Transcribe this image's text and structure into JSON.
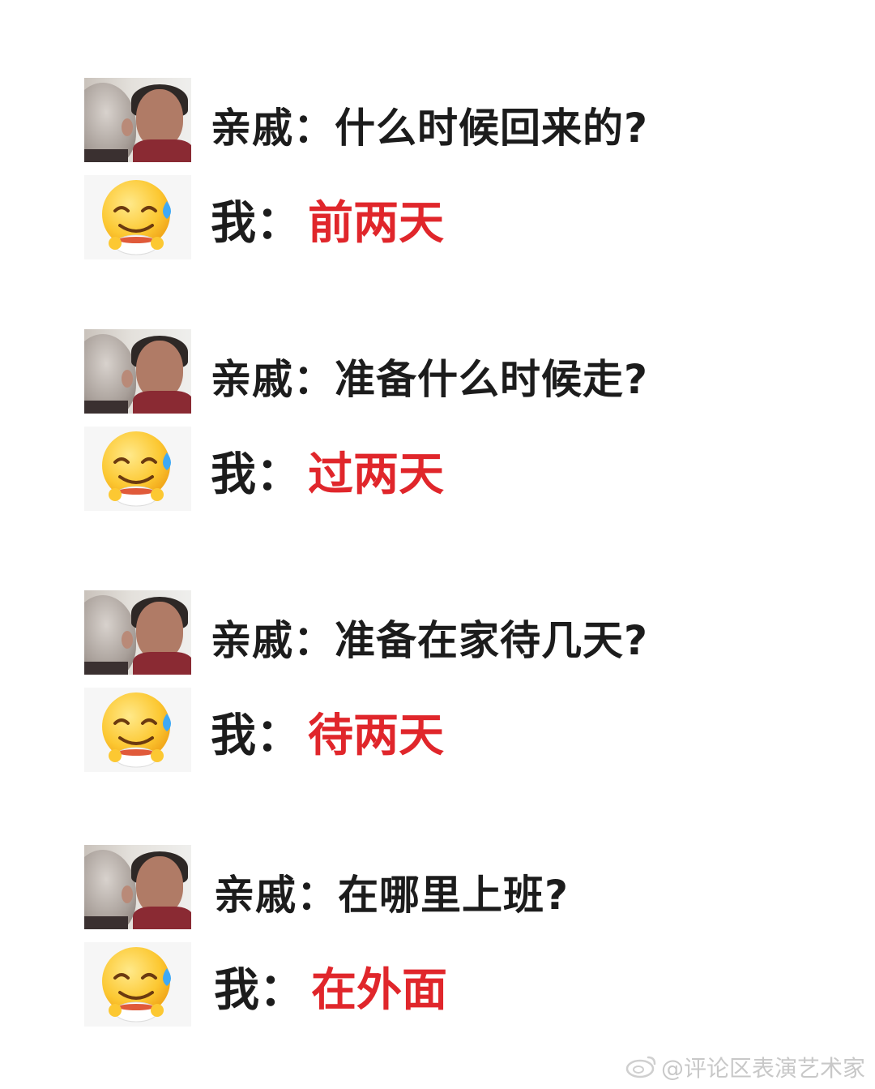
{
  "pairs": [
    {
      "speaker": "亲戚：",
      "question": "什么时候回来的?",
      "me": "我：",
      "answer": "前两天"
    },
    {
      "speaker": "亲戚：",
      "question": "准备什么时候走?",
      "me": "我：",
      "answer": "过两天"
    },
    {
      "speaker": "亲戚：",
      "question": "准备在家待几天?",
      "me": "我：",
      "answer": "待两天"
    },
    {
      "speaker": "亲戚：",
      "question": "在哪里上班?",
      "me": "我：",
      "answer": "在外面"
    }
  ],
  "watermark": "@评论区表演艺术家",
  "icons": {
    "relative": "elderly-women-photo",
    "me": "smiling-sweat-emoji",
    "watermark": "weibo-logo-icon"
  },
  "colors": {
    "answer": "#e0262b",
    "text": "#1c1c1c"
  }
}
